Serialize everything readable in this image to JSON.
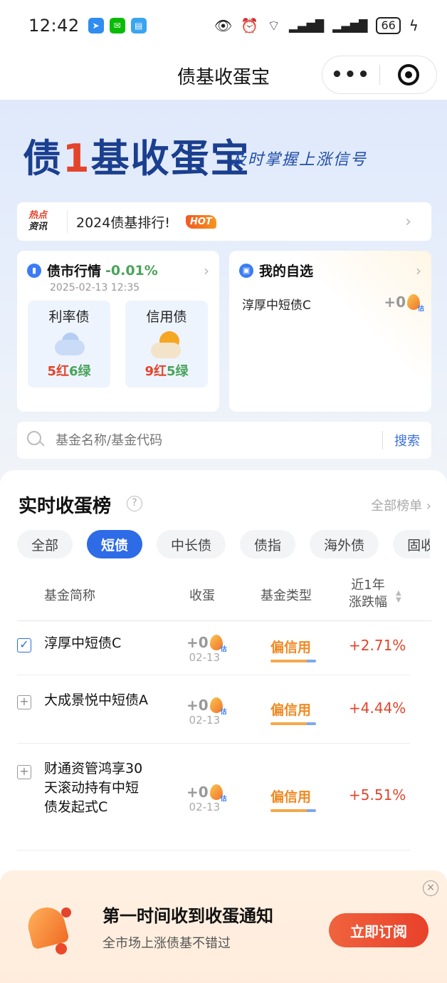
{
  "status_bar": {
    "time": "12:42",
    "battery": "66",
    "icons": [
      "eye-icon",
      "alarm-icon",
      "wifi-icon",
      "signal-icon",
      "signal-icon"
    ]
  },
  "nav": {
    "title": "债基收蛋宝",
    "more": "•••"
  },
  "banner": {
    "brand_a": "债",
    "brand_one": "1",
    "brand_b": "基收蛋宝",
    "slogan": "及时掌握上涨信号"
  },
  "hot": {
    "tag_top": "热点",
    "tag_bottom": "资讯",
    "text": "2024债基排行!",
    "badge": "HOT"
  },
  "market": {
    "title": "债市行情",
    "change": "-0.01%",
    "date": "2025-02-13 12:35",
    "cards": [
      {
        "title": "利率债",
        "red": "5红",
        "green": "6绿"
      },
      {
        "title": "信用债",
        "red": "9红",
        "green": "5绿"
      }
    ]
  },
  "favorites": {
    "title": "我的自选",
    "item_name": "淳厚中短债C",
    "item_value": "+0",
    "est": "估"
  },
  "search": {
    "placeholder": "基金名称/基金代码",
    "button": "搜索"
  },
  "ranking": {
    "title": "实时收蛋榜",
    "help": "?",
    "all": "全部榜单 ›",
    "tabs": [
      "全部",
      "短债",
      "中长债",
      "债指",
      "海外债",
      "固收+"
    ],
    "active_tab": "短债",
    "headers": {
      "name": "基金简称",
      "egg": "收蛋",
      "type": "基金类型",
      "change_line1": "近1年",
      "change_line2": "涨跌幅"
    },
    "rows": [
      {
        "name": "淳厚中短债C",
        "egg": "+0",
        "est": "估",
        "date": "02-13",
        "type": "偏信用",
        "change": "+2.71%",
        "checked": true
      },
      {
        "name": "大成景悦中短债A",
        "egg": "+0",
        "est": "估",
        "date": "02-13",
        "type": "偏信用",
        "change": "+4.44%",
        "checked": false
      },
      {
        "name": "财通资管鸿享30天滚动持有中短债发起式C",
        "egg": "+0",
        "est": "估",
        "date": "02-13",
        "type": "偏信用",
        "change": "+5.51%",
        "checked": false
      }
    ]
  },
  "subscribe": {
    "title": "第一时间收到收蛋通知",
    "desc": "全市场上涨债基不错过",
    "button": "立即订阅",
    "close": "×"
  },
  "colors": {
    "primary": "#2e6be6",
    "up": "#e2452c",
    "down": "#49a35b",
    "credit": "#f08a24"
  }
}
